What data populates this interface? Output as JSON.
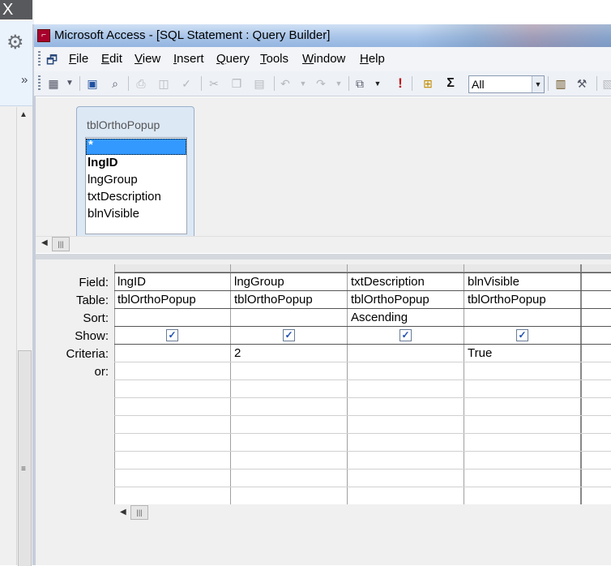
{
  "window": {
    "title": "Microsoft Access - [SQL Statement : Query Builder]",
    "close_glyph": "X",
    "chevrons_glyph": "»"
  },
  "menu": {
    "items": [
      {
        "label": "File",
        "accel": "F",
        "rest": "ile"
      },
      {
        "label": "Edit",
        "accel": "E",
        "rest": "dit"
      },
      {
        "label": "View",
        "accel": "V",
        "rest": "iew"
      },
      {
        "label": "Insert",
        "accel": "I",
        "rest": "nsert"
      },
      {
        "label": "Query",
        "accel": "Q",
        "rest": "uery"
      },
      {
        "label": "Tools",
        "accel": "T",
        "rest": "ools"
      },
      {
        "label": "Window",
        "accel": "W",
        "rest": "indow"
      },
      {
        "label": "Help",
        "accel": "H",
        "rest": "elp"
      }
    ]
  },
  "toolbar": {
    "top_values": "All",
    "icons": [
      "view-icon",
      "save-icon",
      "search-icon",
      "print-icon",
      "print-preview-icon",
      "spelling-icon",
      "cut-icon",
      "copy-icon",
      "paste-icon",
      "undo-icon",
      "redo-icon",
      "query-type-icon",
      "run-icon",
      "show-table-icon",
      "totals-icon",
      "properties-icon",
      "build-icon"
    ]
  },
  "table_box": {
    "name": "tblOrthoPopup",
    "fields": [
      "*",
      "lngID",
      "lngGroup",
      "txtDescription",
      "blnVisible"
    ]
  },
  "grid": {
    "row_labels": {
      "field": "Field:",
      "table": "Table:",
      "sort": "Sort:",
      "show": "Show:",
      "criteria": "Criteria:",
      "or": "or:"
    },
    "columns": [
      {
        "field": "lngID",
        "table": "tblOrthoPopup",
        "sort": "",
        "show": true,
        "criteria": ""
      },
      {
        "field": "lngGroup",
        "table": "tblOrthoPopup",
        "sort": "",
        "show": true,
        "criteria": "2"
      },
      {
        "field": "txtDescription",
        "table": "tblOrthoPopup",
        "sort": "Ascending",
        "show": true,
        "criteria": ""
      },
      {
        "field": "blnVisible",
        "table": "tblOrthoPopup",
        "sort": "",
        "show": true,
        "criteria": "True"
      }
    ],
    "check_glyph": "✓"
  },
  "colors": {
    "selected_field_bg": "#3399ff",
    "title_bar": "#a8c4e8"
  }
}
